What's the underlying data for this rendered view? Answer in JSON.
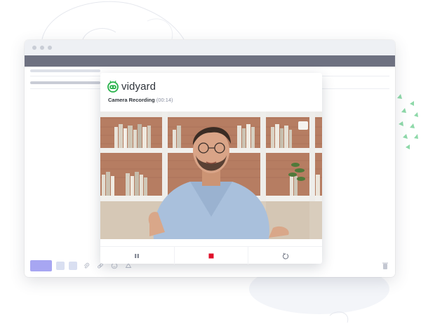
{
  "widget": {
    "logo_text": "vidyard",
    "recording_label": "Camera Recording",
    "recording_time": "(00:14)"
  },
  "icons": {
    "logo": "vidyard-robot-icon",
    "pause": "pause-icon",
    "stop": "stop-icon",
    "restart": "restart-icon",
    "attach": "paperclip-icon",
    "link": "link-icon",
    "emoji": "emoji-icon",
    "drive": "drive-icon",
    "trash": "trash-icon"
  },
  "colors": {
    "accent_green": "#27b24a",
    "stop_red": "#e0102a",
    "send_button": "#a7a6f2",
    "toolbar": "#6e7181"
  }
}
